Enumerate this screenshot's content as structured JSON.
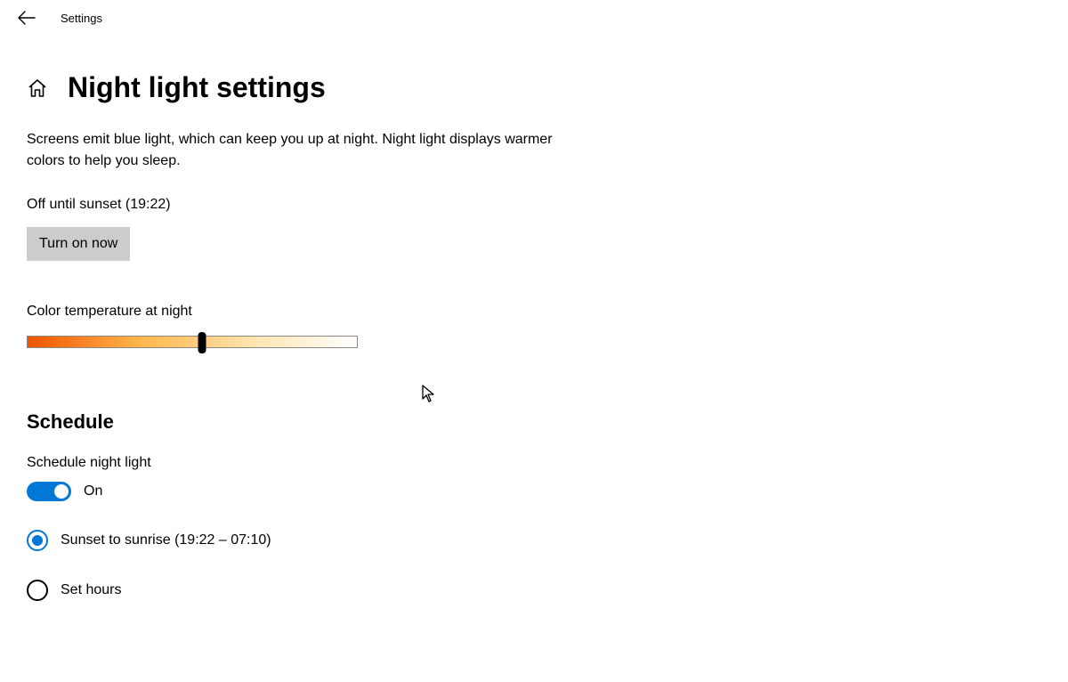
{
  "header": {
    "label": "Settings"
  },
  "title": "Night light settings",
  "description": "Screens emit blue light, which can keep you up at night. Night light displays warmer colors to help you sleep.",
  "status": "Off until sunset (19:22)",
  "turnOnLabel": "Turn on now",
  "slider": {
    "label": "Color temperature at night",
    "valuePercent": 53
  },
  "schedule": {
    "sectionTitle": "Schedule",
    "toggleLabel": "Schedule night light",
    "toggleState": "On",
    "options": {
      "sunset": "Sunset to sunrise (19:22 – 07:10)",
      "setHours": "Set hours"
    },
    "selected": "sunset"
  }
}
